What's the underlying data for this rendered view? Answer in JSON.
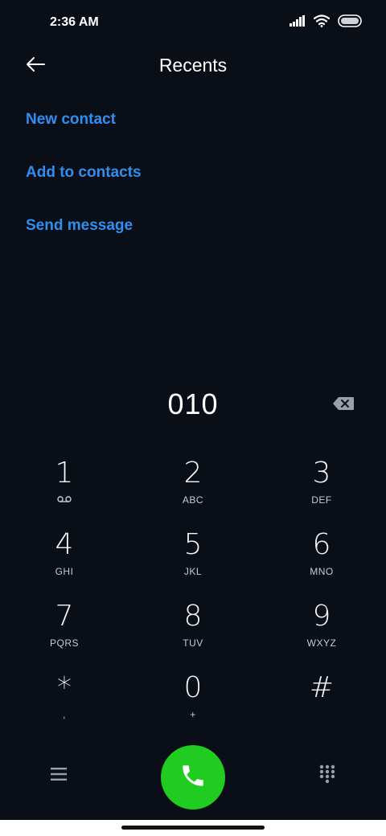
{
  "status_bar": {
    "time": "2:36 AM",
    "icons": [
      "signal-icon",
      "wifi-icon",
      "battery-icon"
    ]
  },
  "header": {
    "title": "Recents",
    "back_icon": "back-arrow-icon"
  },
  "actions": [
    {
      "label": "New contact"
    },
    {
      "label": "Add to contacts"
    },
    {
      "label": "Send message"
    }
  ],
  "dialer": {
    "number": "010",
    "backspace_icon": "backspace-icon",
    "keys": [
      {
        "digit": "1",
        "letters": "",
        "sub_icon": "voicemail-icon"
      },
      {
        "digit": "2",
        "letters": "ABC"
      },
      {
        "digit": "3",
        "letters": "DEF"
      },
      {
        "digit": "4",
        "letters": "GHI"
      },
      {
        "digit": "5",
        "letters": "JKL"
      },
      {
        "digit": "6",
        "letters": "MNO"
      },
      {
        "digit": "7",
        "letters": "PQRS"
      },
      {
        "digit": "8",
        "letters": "TUV"
      },
      {
        "digit": "9",
        "letters": "WXYZ"
      },
      {
        "digit": "*",
        "letters": ","
      },
      {
        "digit": "0",
        "letters": "+"
      },
      {
        "digit": "#",
        "letters": ""
      }
    ]
  },
  "bottom_bar": {
    "menu_icon": "menu-icon",
    "call_icon": "phone-icon",
    "dialpad_icon": "dialpad-icon"
  },
  "colors": {
    "background": "#0a0f17",
    "link": "#2f8ff0",
    "call_button": "#1fcc1f"
  }
}
